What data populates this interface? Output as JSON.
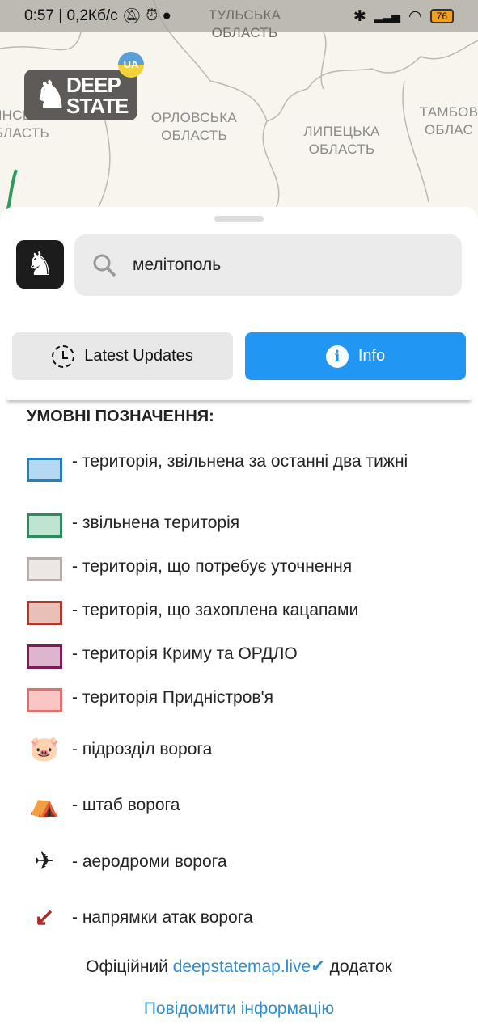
{
  "status_bar": {
    "time": "0:57",
    "speed": "0,2Кб/с",
    "battery": "76"
  },
  "map": {
    "regions": [
      "ТУЛЬСЬКА ОБЛАСТЬ",
      "ОРЛОВСЬКА ОБЛАСТЬ",
      "ЛИПЕЦЬКА ОБЛАСТЬ",
      "ТАМБОВ ОБЛАС",
      "РЯНСЬКА ОБЛАСТЬ"
    ],
    "logo": "DEEP STATE",
    "badge": "UA"
  },
  "search": {
    "value": "мелітополь"
  },
  "tabs": {
    "latest": "Latest Updates",
    "info": "Info"
  },
  "legend": {
    "title": "УМОВНІ ПОЗНАЧЕННЯ:",
    "items": [
      {
        "label": "- територія, звільнена за останні два тижні",
        "fill": "#b5d9f2",
        "border": "#2a7fb8"
      },
      {
        "label": "- звільнена територія",
        "fill": "#bfe5d2",
        "border": "#2e8b5e"
      },
      {
        "label": "- територія, що потребує уточнення",
        "fill": "#ece7e5",
        "border": "#b8aca8"
      },
      {
        "label": "- територія, що захоплена кацапами",
        "fill": "#e8c0b8",
        "border": "#a83a2e"
      },
      {
        "label": "- територія Криму та ОРДЛО",
        "fill": "#ddb5cf",
        "border": "#7a1f55"
      },
      {
        "label": "- територія Придністров'я",
        "fill": "#f9c6c4",
        "border": "#e07070"
      },
      {
        "label": "- підрозділ ворога",
        "icon": "enemy-unit-icon"
      },
      {
        "label": "- штаб ворога",
        "icon": "enemy-hq-icon"
      },
      {
        "label": "- аеродроми ворога",
        "icon": "enemy-airfield-icon"
      },
      {
        "label": "- напрямки атак ворога",
        "icon": "attack-direction-icon"
      }
    ]
  },
  "footer": {
    "prefix": "Офіційний",
    "link": "deepstatemap.live",
    "suffix": "додаток",
    "report": "Повідомити інформацію"
  }
}
